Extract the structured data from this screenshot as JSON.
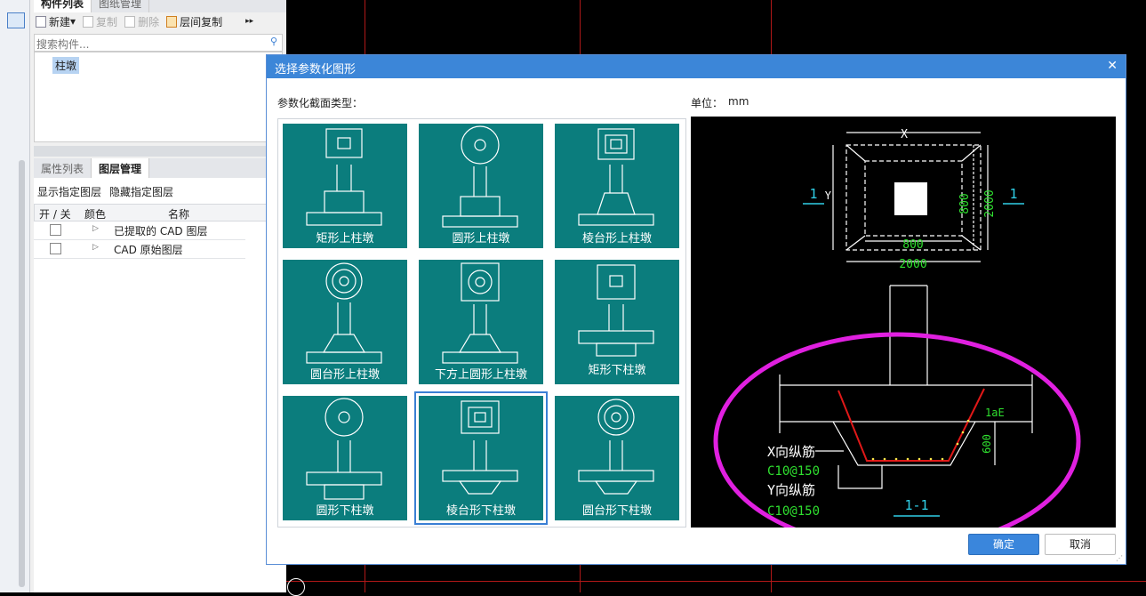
{
  "left_panel": {
    "tabs_top": [
      "构件列表",
      "图纸管理"
    ],
    "toolbar": {
      "new": "新建",
      "copy": "复制",
      "delete": "删除",
      "floor_copy": "层间复制"
    },
    "search_placeholder": "搜索构件...",
    "tree_item": "柱墩",
    "tabs_bottom": [
      "属性列表",
      "图层管理"
    ],
    "layer_actions": {
      "show": "显示指定图层",
      "hide": "隐藏指定图层"
    },
    "layer_table": {
      "headers": [
        "开 / 关",
        "颜色",
        "名称"
      ],
      "rows": [
        {
          "name": "已提取的 CAD 图层"
        },
        {
          "name": "CAD 原始图层"
        }
      ]
    }
  },
  "dialog": {
    "title": "选择参数化图形",
    "section_label": "参数化截面类型：",
    "unit_label": "单位：",
    "unit_value": "mm",
    "shapes": [
      "矩形上柱墩",
      "圆形上柱墩",
      "棱台形上柱墩",
      "圆台形上柱墩",
      "下方上圆形上柱墩",
      "矩形下柱墩",
      "圆形下柱墩",
      "棱台形下柱墩",
      "圆台形下柱墩"
    ],
    "selected_index": 7,
    "ok_label": "确定",
    "cancel_label": "取消"
  },
  "preview": {
    "dim_x": "X",
    "dim_y": "Y",
    "dim_inner_h": "800",
    "dim_outer_h": "2000",
    "dim_inner_w": "800",
    "dim_outer_w": "2000",
    "section_mark": "1",
    "anchor_label": "1aE",
    "depth_label": "600",
    "x_rebar_label": "X向纵筋",
    "x_rebar_spec": "C10@150",
    "y_rebar_label": "Y向纵筋",
    "y_rebar_spec": "C10@150",
    "section_title": "1-1"
  },
  "colors": {
    "cell_bg": "#0b7d7d",
    "title_bar": "#3c86d8",
    "highlight": "#e020e0",
    "rebar": "#e01818",
    "dim_green": "#2fe02f",
    "mark_cyan": "#30d0e8"
  }
}
